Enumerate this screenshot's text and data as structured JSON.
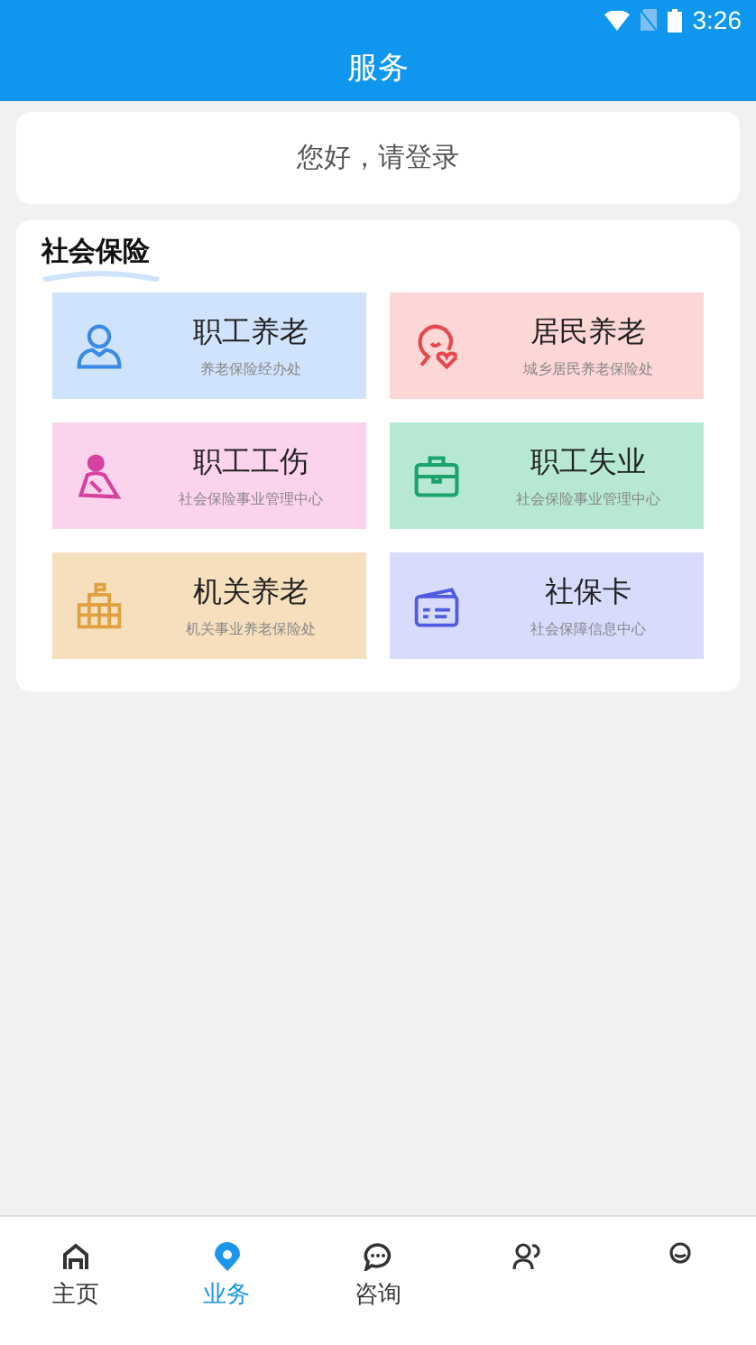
{
  "status_bar": {
    "time": "3:26"
  },
  "header": {
    "title": "服务"
  },
  "login": {
    "text": "您好，请登录"
  },
  "section": {
    "title": "社会保险",
    "items": [
      {
        "title": "职工养老",
        "subtitle": "养老保险经办处",
        "kind": "person",
        "color": "#cfe4fc"
      },
      {
        "title": "居民养老",
        "subtitle": "城乡居民养老保险处",
        "kind": "heart",
        "color": "#fdd6d6"
      },
      {
        "title": "职工工伤",
        "subtitle": "社会保险事业管理中心",
        "kind": "injury",
        "color": "#fcd3ec"
      },
      {
        "title": "职工失业",
        "subtitle": "社会保险事业管理中心",
        "kind": "briefcase",
        "color": "#b6e8d4"
      },
      {
        "title": "机关养老",
        "subtitle": "机关事业养老保险处",
        "kind": "building",
        "color": "#f6dfbd"
      },
      {
        "title": "社保卡",
        "subtitle": "社会保障信息中心",
        "kind": "card",
        "color": "#d7dbfc"
      }
    ]
  },
  "tabs": [
    {
      "label": "主页",
      "kind": "home",
      "selected": false
    },
    {
      "label": "业务",
      "kind": "pin",
      "selected": true
    },
    {
      "label": "咨询",
      "kind": "chat",
      "selected": false
    },
    {
      "kind": "people",
      "selected": false
    },
    {
      "kind": "user",
      "selected": false
    }
  ]
}
